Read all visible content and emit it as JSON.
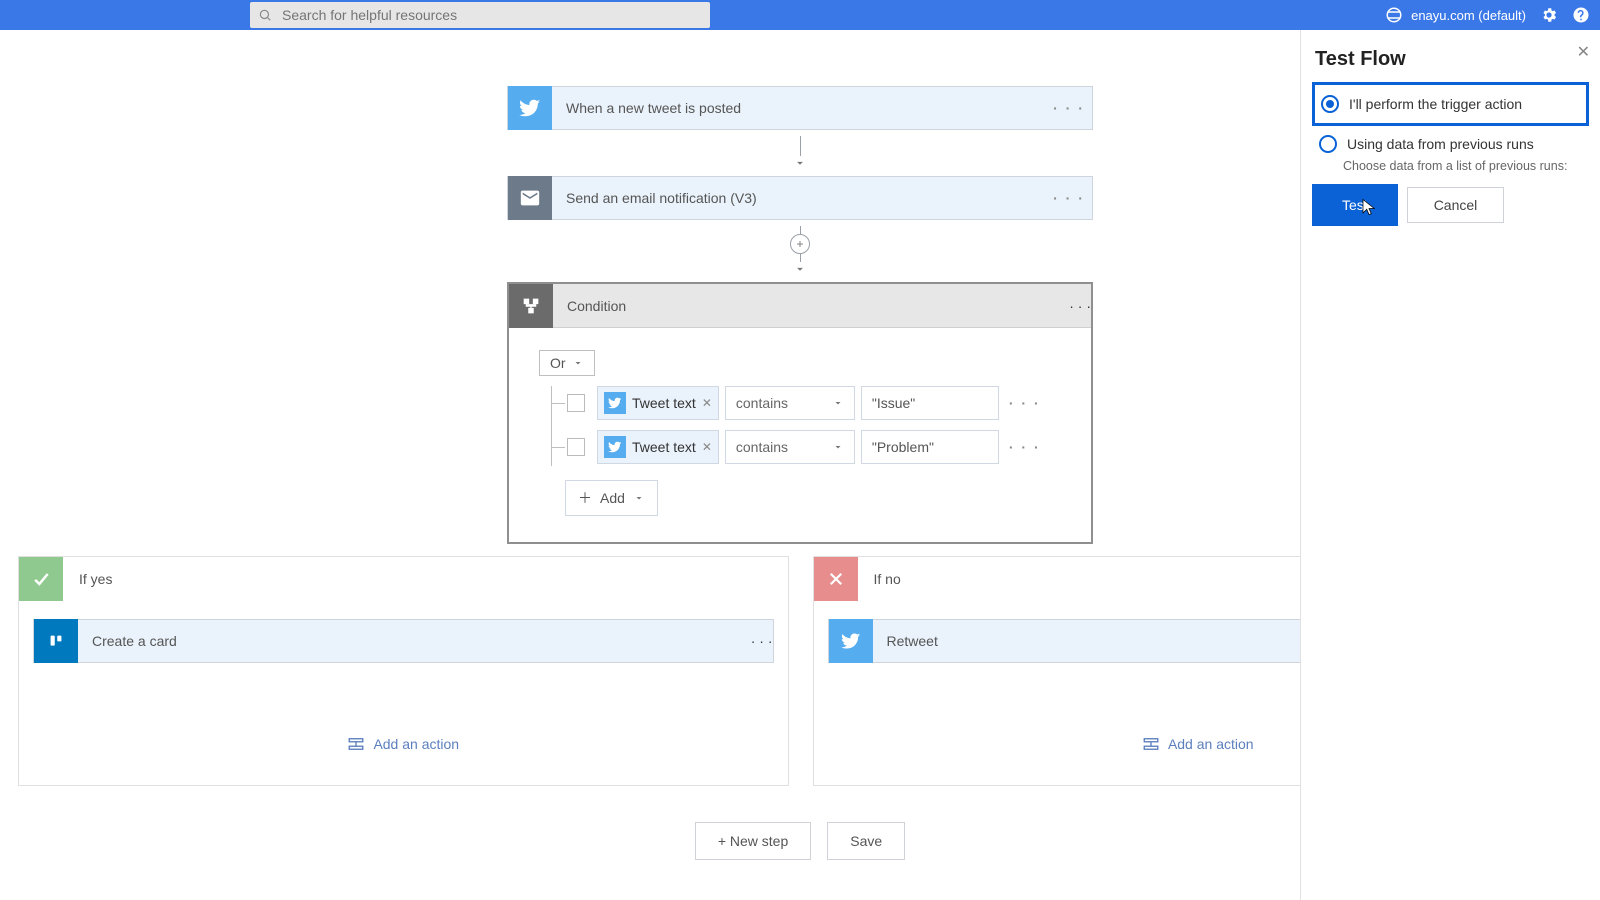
{
  "header": {
    "search_placeholder": "Search for helpful resources",
    "env_domain": "enayu.com (default)"
  },
  "flow": {
    "trigger": {
      "title": "When a new tweet is posted"
    },
    "action1": {
      "title": "Send an email notification (V3)"
    },
    "condition": {
      "title": "Condition",
      "group_op": "Or",
      "rows": [
        {
          "token": "Tweet text",
          "operator": "contains",
          "value": "\"Issue\""
        },
        {
          "token": "Tweet text",
          "operator": "contains",
          "value": "\"Problem\""
        }
      ],
      "add_label": "Add"
    },
    "yes": {
      "label": "If yes",
      "action": "Create a card",
      "add_action": "Add an action"
    },
    "no": {
      "label": "If no",
      "action": "Retweet",
      "add_action": "Add an action"
    },
    "new_step": "+ New step",
    "save": "Save"
  },
  "panel": {
    "title": "Test Flow",
    "opt1": "I'll perform the trigger action",
    "opt2": "Using data from previous runs",
    "opt2_hint": "Choose data from a list of previous runs:",
    "test": "Test",
    "cancel": "Cancel"
  }
}
